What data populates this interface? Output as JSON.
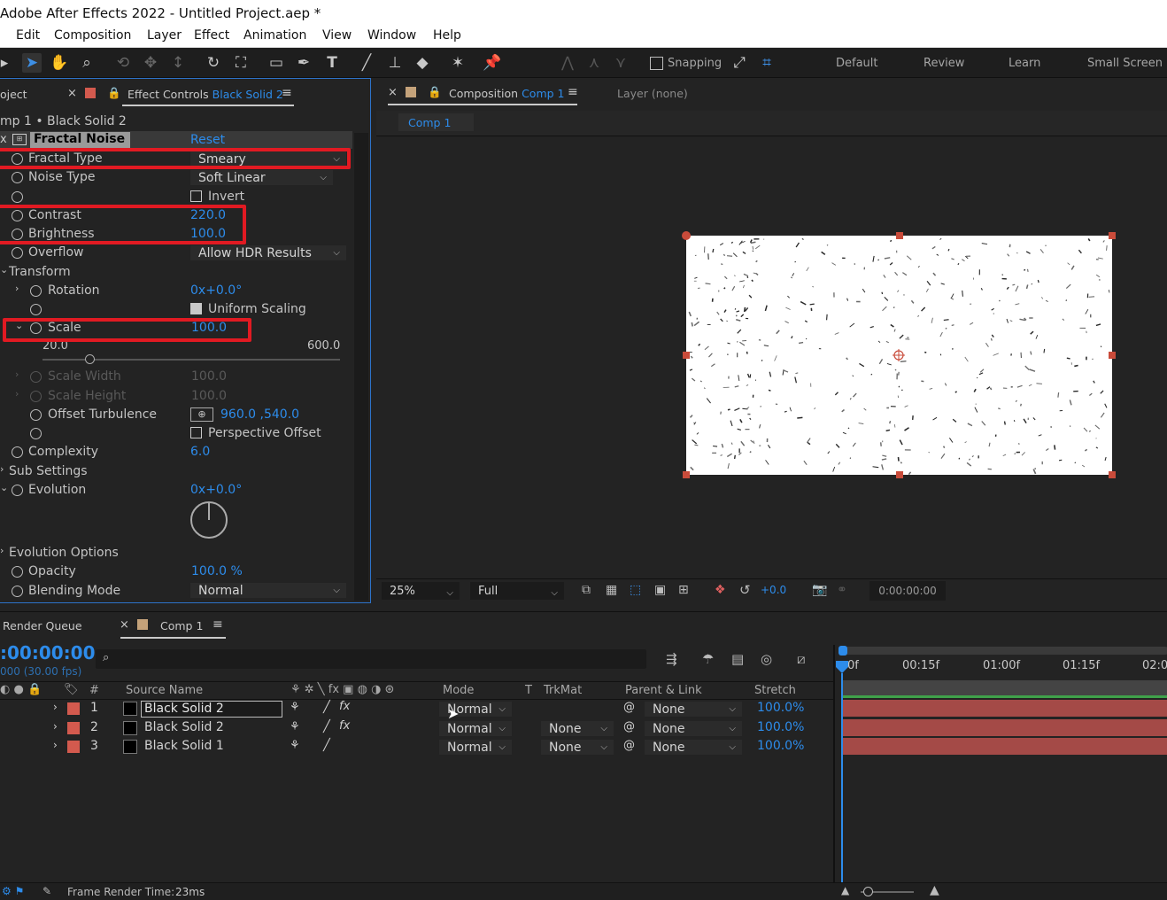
{
  "title": "Adobe After Effects 2022 - Untitled Project.aep *",
  "menu": [
    "Edit",
    "Composition",
    "Layer",
    "Effect",
    "Animation",
    "View",
    "Window",
    "Help"
  ],
  "toolbar": {
    "snapping": "Snapping",
    "workspaces": [
      "Default",
      "Review",
      "Learn",
      "Small Screen"
    ]
  },
  "left_tabs": {
    "project": "oject",
    "effect_controls": "Effect Controls",
    "effect_layer": "Black Solid 2"
  },
  "effect_header": "mp 1 • Black Solid 2",
  "effect": {
    "name": "Fractal Noise",
    "reset": "Reset",
    "props": [
      {
        "label": "Fractal Type",
        "value": "Smeary"
      },
      {
        "label": "Noise Type",
        "value": "Soft Linear"
      },
      {
        "label": "",
        "value": "Invert"
      },
      {
        "label": "Contrast",
        "value": "220.0"
      },
      {
        "label": "Brightness",
        "value": "100.0"
      },
      {
        "label": "Overflow",
        "value": "Allow HDR Results"
      },
      {
        "label": "Transform",
        "value": ""
      },
      {
        "label": "Rotation",
        "value": "0x+0.0°"
      },
      {
        "label": "",
        "value": "Uniform Scaling"
      },
      {
        "label": "Scale",
        "value": "100.0"
      },
      {
        "label": "20.0",
        "value": "600.0"
      },
      {
        "label": "Scale Width",
        "value": "100.0"
      },
      {
        "label": "Scale Height",
        "value": "100.0"
      },
      {
        "label": "Offset Turbulence",
        "value": "960.0 ,540.0"
      },
      {
        "label": "",
        "value": "Perspective Offset"
      },
      {
        "label": "Complexity",
        "value": "6.0"
      },
      {
        "label": "Sub Settings",
        "value": ""
      },
      {
        "label": "Evolution",
        "value": "0x+0.0°"
      },
      {
        "label": "Evolution Options",
        "value": ""
      },
      {
        "label": "Opacity",
        "value": "100.0 %"
      },
      {
        "label": "Blending Mode",
        "value": "Normal"
      }
    ]
  },
  "comp_panel": {
    "tab": "Composition",
    "comp": "Comp 1",
    "layer_tab": "Layer (none)",
    "subtab": "Comp 1",
    "zoom": "25%",
    "resolution": "Full",
    "exposure": "+0.0",
    "timecode": "0:00:00:00"
  },
  "timeline": {
    "render_queue": "Render Queue",
    "comp_tab": "Comp 1",
    "time": ":00:00:00",
    "fps": "000 (30.00 fps)",
    "ruler": [
      "0f",
      "00:15f",
      "01:00f",
      "01:15f",
      "02:0"
    ],
    "columns": {
      "num": "#",
      "source": "Source Name",
      "mode": "Mode",
      "t": "T",
      "trkmat": "TrkMat",
      "parent": "Parent & Link",
      "stretch": "Stretch"
    },
    "layers": [
      {
        "num": "1",
        "name": "Black Solid 2",
        "mode": "Normal",
        "trkmat": "",
        "parent": "None",
        "stretch": "100.0%"
      },
      {
        "num": "2",
        "name": "Black Solid 2",
        "mode": "Normal",
        "trkmat": "None",
        "parent": "None",
        "stretch": "100.0%"
      },
      {
        "num": "3",
        "name": "Black Solid 1",
        "mode": "Normal",
        "trkmat": "None",
        "parent": "None",
        "stretch": "100.0%"
      }
    ]
  },
  "status": {
    "label": "Frame Render Time:",
    "value": "23ms"
  },
  "colors": {
    "accent": "#2d8ceb",
    "highlight": "#e11a22",
    "label_red": "#d35a4e",
    "layer_bar": "#a44a47"
  }
}
